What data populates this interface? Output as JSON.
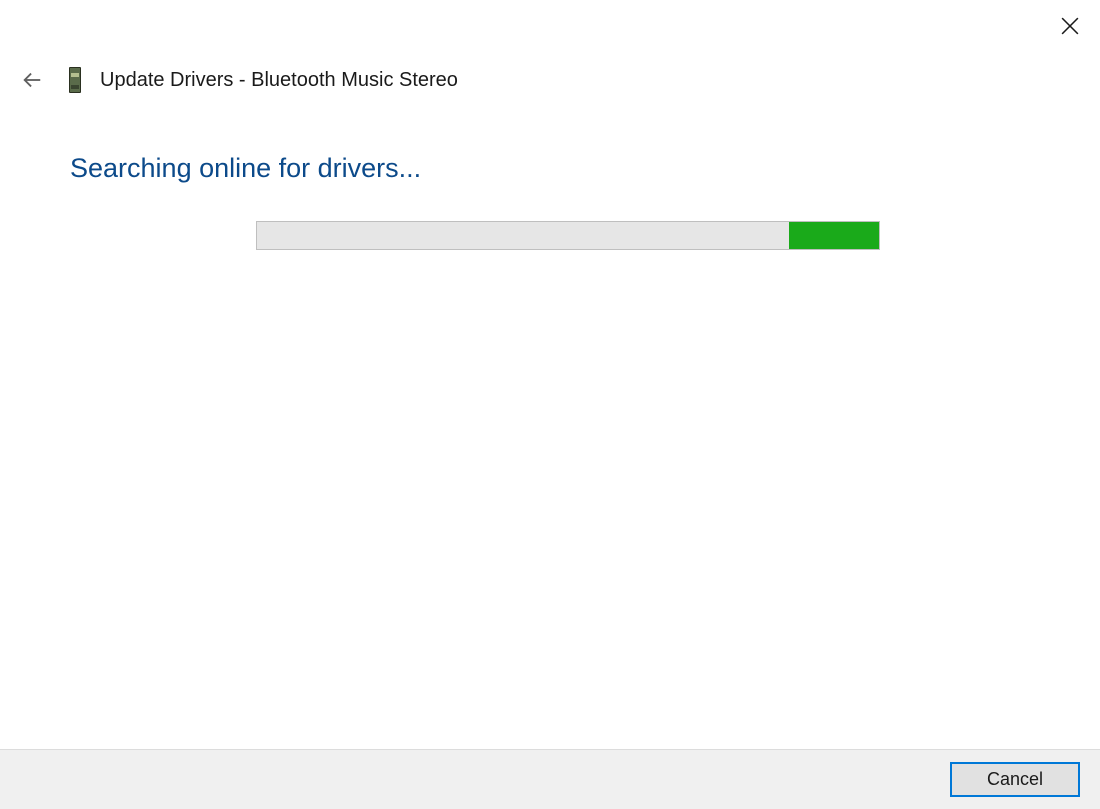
{
  "window": {
    "title": "Update Drivers - Bluetooth Music Stereo"
  },
  "status_message": "Searching online for drivers...",
  "progress": {
    "indeterminate": true
  },
  "footer": {
    "cancel_label": "Cancel"
  }
}
